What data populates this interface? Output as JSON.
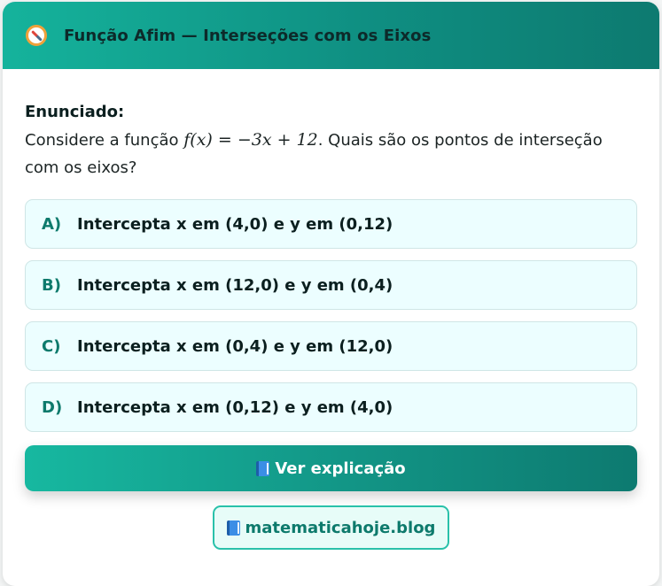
{
  "header": {
    "icon": "compass-icon",
    "title": "Função Afim — Interseções com os Eixos"
  },
  "statement": {
    "label": "Enunciado:",
    "pre": "Considere a função ",
    "math": "f(x) = −3x + 12",
    "post": ". Quais são os pontos de interseção com os eixos?"
  },
  "options": [
    {
      "letter": "A)",
      "text": "Intercepta x em (4,0) e y em (0,12)"
    },
    {
      "letter": "B)",
      "text": "Intercepta x em (12,0) e y em (0,4)"
    },
    {
      "letter": "C)",
      "text": "Intercepta x em (0,4) e y em (12,0)"
    },
    {
      "letter": "D)",
      "text": "Intercepta x em (0,12) e y em (4,0)"
    }
  ],
  "explain_button": {
    "icon": "book-icon",
    "label": "Ver explicação"
  },
  "site_link": {
    "icon": "book-icon",
    "label": "matematicahoje.blog"
  },
  "colors": {
    "accent": "#15b39c",
    "accent_dark": "#0d7a70",
    "option_bg": "#ecfeff"
  }
}
